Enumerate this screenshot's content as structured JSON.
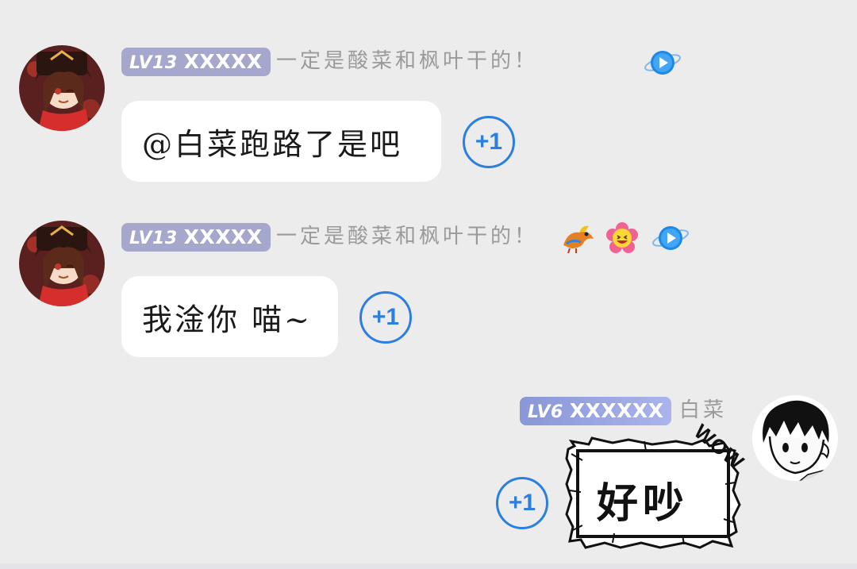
{
  "messages": [
    {
      "level": "LV13",
      "badge_name": "XXXXX",
      "username": "一定是酸菜和枫叶干的！",
      "text": "@白菜跑路了是吧",
      "plus_label": "+1",
      "icons": [
        "play-badge-icon"
      ]
    },
    {
      "level": "LV13",
      "badge_name": "XXXXX",
      "username": "一定是酸菜和枫叶干的！",
      "text": "我淦你 喵~",
      "plus_label": "+1",
      "icons": [
        "dragon-icon",
        "laughing-flower-icon",
        "play-badge-icon"
      ]
    },
    {
      "level": "LV6",
      "badge_name": "XXXXXX",
      "username": "白菜",
      "sticker_text": "好吵",
      "sticker_burst": "WOW",
      "plus_label": "+1"
    }
  ],
  "colors": {
    "background": "#ececed",
    "plus_accent": "#2a7fe0",
    "badge_purple": "#a5a8cc",
    "badge_blue": "#8a97d6"
  }
}
